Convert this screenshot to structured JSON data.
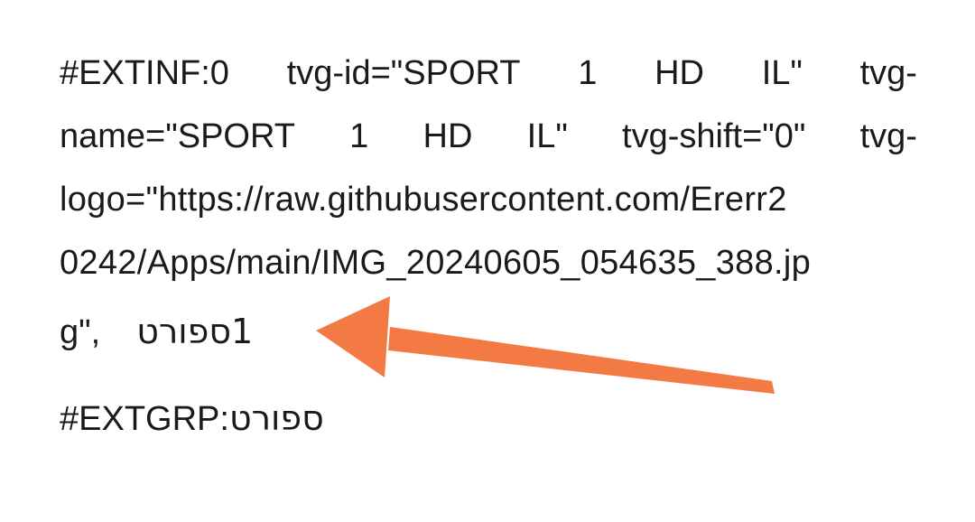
{
  "text": {
    "line1": [
      "#EXTINF:0",
      "tvg-id=\"SPORT",
      "1",
      "HD",
      "IL\"",
      "tvg-"
    ],
    "line2": [
      "name=\"SPORT",
      "1",
      "HD",
      "IL\"",
      "tvg-shift=\"0\"",
      "tvg-"
    ],
    "line3": "logo=\"https://raw.githubusercontent.com/Ererr2",
    "line4": "0242/Apps/main/IMG_20240605_054635_388.jp",
    "line5_prefix": "g\",",
    "line5_channel": "1ספורט",
    "line6_prefix": "#EXTGRP:",
    "line6_group": "ספורט"
  },
  "annotation": {
    "arrow_color": "#F47A45",
    "arrow_points_to": "line5_channel"
  }
}
